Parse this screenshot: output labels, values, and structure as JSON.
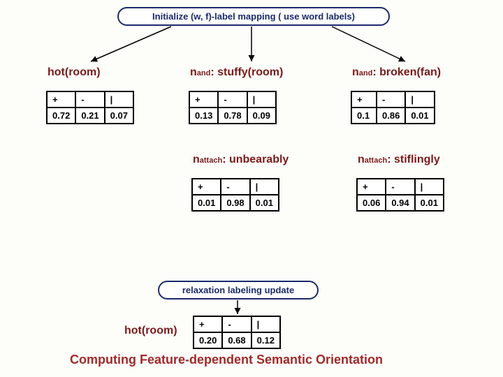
{
  "initialize": "Initialize (w, f)-label mapping  ( use word labels)",
  "nodes": {
    "hot": {
      "title": "hot(room)",
      "cols": [
        "+",
        "-",
        "|"
      ],
      "vals": [
        "0.72",
        "0.21",
        "0.07"
      ]
    },
    "stuffy": {
      "prefix": "n",
      "sub": "and",
      "rest": ": stuffy(room)",
      "cols": [
        "+",
        "-",
        "|"
      ],
      "vals": [
        "0.13",
        "0.78",
        "0.09"
      ]
    },
    "broken": {
      "prefix": "n",
      "sub": "and",
      "rest": ": broken(fan)",
      "cols": [
        "+",
        "-",
        "|"
      ],
      "vals": [
        "0.1",
        "0.86",
        "0.01"
      ]
    },
    "unbearably": {
      "prefix": "n",
      "sub": "attach",
      "rest": ": unbearably",
      "cols": [
        "+",
        "-",
        "|"
      ],
      "vals": [
        "0.01",
        "0.98",
        "0.01"
      ]
    },
    "stiflingly": {
      "prefix": "n",
      "sub": "attach",
      "rest": ": stiflingly",
      "cols": [
        "+",
        "-",
        "|"
      ],
      "vals": [
        "0.06",
        "0.94",
        "0.01"
      ]
    }
  },
  "relax": "relaxation labeling update",
  "final": {
    "title": "hot(room)",
    "cols": [
      "+",
      "-",
      "|"
    ],
    "vals": [
      "0.20",
      "0.68",
      "0.12"
    ]
  },
  "footer": "Computing Feature-dependent Semantic Orientation"
}
